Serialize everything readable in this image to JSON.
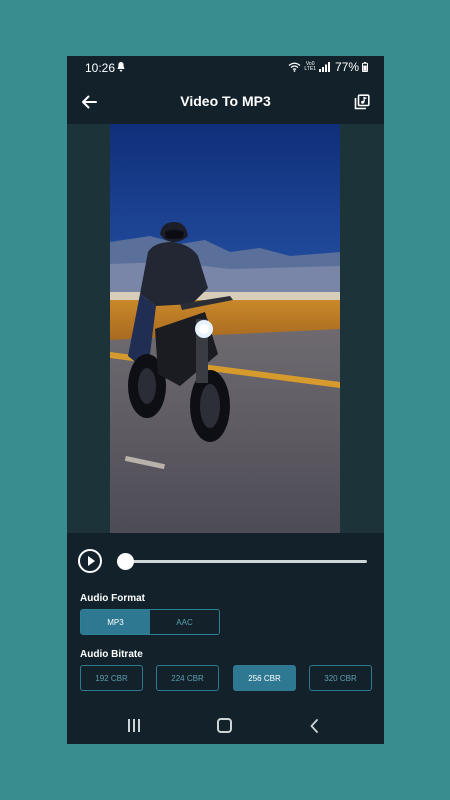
{
  "status_bar": {
    "time": "10:26",
    "network_top": "Vo0",
    "network_bottom": "LTE1",
    "battery": "77%"
  },
  "app_bar": {
    "title": "Video To MP3",
    "back_icon": "arrow-left-icon",
    "media_icon": "media-library-icon"
  },
  "player": {
    "play_icon": "play-circle-icon",
    "progress": 0
  },
  "audio_format": {
    "label": "Audio Format",
    "options": [
      "MP3",
      "AAC"
    ],
    "selected": "MP3"
  },
  "audio_bitrate": {
    "label": "Audio Bitrate",
    "options": [
      "192 CBR",
      "224 CBR",
      "256 CBR",
      "320 CBR"
    ],
    "selected": "256 CBR"
  },
  "colors": {
    "background": "#3a8d8f",
    "app_background": "#13222a",
    "accent": "#2e7892"
  }
}
